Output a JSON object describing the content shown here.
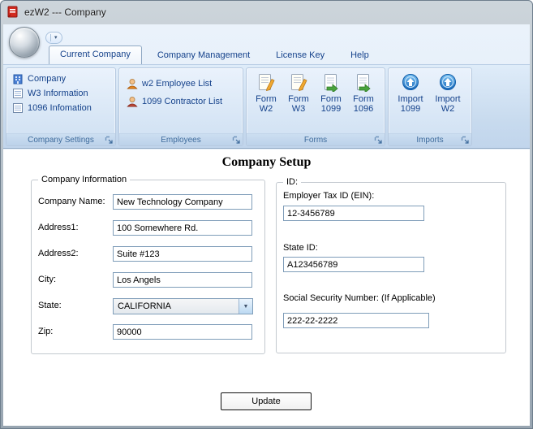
{
  "window": {
    "title": "ezW2 --- Company",
    "app_icon": "ezw2-red-book-icon"
  },
  "quick_access": {
    "dropdown_icon": "chevron-down-icon"
  },
  "ribbon": {
    "tabs": [
      {
        "label": "Current Company",
        "active": true
      },
      {
        "label": "Company Management",
        "active": false
      },
      {
        "label": "License Key",
        "active": false
      },
      {
        "label": "Help",
        "active": false
      }
    ],
    "groups": [
      {
        "label": "Company Settings",
        "items": [
          {
            "label": "Company",
            "icon": "building-icon"
          },
          {
            "label": "W3 Information",
            "icon": "form-grid-icon"
          },
          {
            "label": "1096 Infomation",
            "icon": "form-grid-icon"
          }
        ]
      },
      {
        "label": "Employees",
        "items": [
          {
            "label": "w2 Employee List",
            "icon": "employee-person-icon"
          },
          {
            "label": "1099 Contractor List",
            "icon": "contractor-person-icon"
          }
        ]
      },
      {
        "label": "Forms",
        "items": [
          {
            "line1": "Form",
            "line2": "W2",
            "icon": "paper-pencil-icon"
          },
          {
            "line1": "Form",
            "line2": "W3",
            "icon": "paper-pencil-icon"
          },
          {
            "line1": "Form",
            "line2": "1099",
            "icon": "paper-green-arrow-icon"
          },
          {
            "line1": "Form",
            "line2": "1096",
            "icon": "paper-green-arrow-icon"
          }
        ]
      },
      {
        "label": "Imports",
        "items": [
          {
            "line1": "Import",
            "line2": "1099",
            "icon": "import-blue-circle-icon"
          },
          {
            "line1": "Import",
            "line2": "W2",
            "icon": "import-blue-circle-icon"
          }
        ]
      }
    ]
  },
  "main": {
    "title": "Company Setup",
    "company_section": {
      "legend": "Company Information",
      "fields": [
        {
          "label": "Company Name:",
          "value": "New Technology Company"
        },
        {
          "label": "Address1:",
          "value": "100 Somewhere Rd."
        },
        {
          "label": "Address2:",
          "value": "Suite #123"
        },
        {
          "label": "City:",
          "value": "Los Angels"
        },
        {
          "label": "State:",
          "value": "CALIFORNIA"
        },
        {
          "label": "Zip:",
          "value": "90000"
        }
      ]
    },
    "id_section": {
      "legend": "ID:",
      "fields": [
        {
          "label": "Employer Tax ID (EIN):",
          "value": "12-3456789"
        },
        {
          "label": "State ID:",
          "value": "A123456789"
        },
        {
          "label": "Social Security Number: (If Applicable)",
          "value": "222-22-2222"
        }
      ]
    },
    "update_button": "Update"
  },
  "colors": {
    "ribbon_text": "#15428b",
    "group_caption_text": "#3e6b9c",
    "ribbon_bg_top": "#dfecf9",
    "ribbon_bg_bottom": "#c1d5ec",
    "input_border": "#7f9db9",
    "app_icon_red": "#d22a1e"
  }
}
